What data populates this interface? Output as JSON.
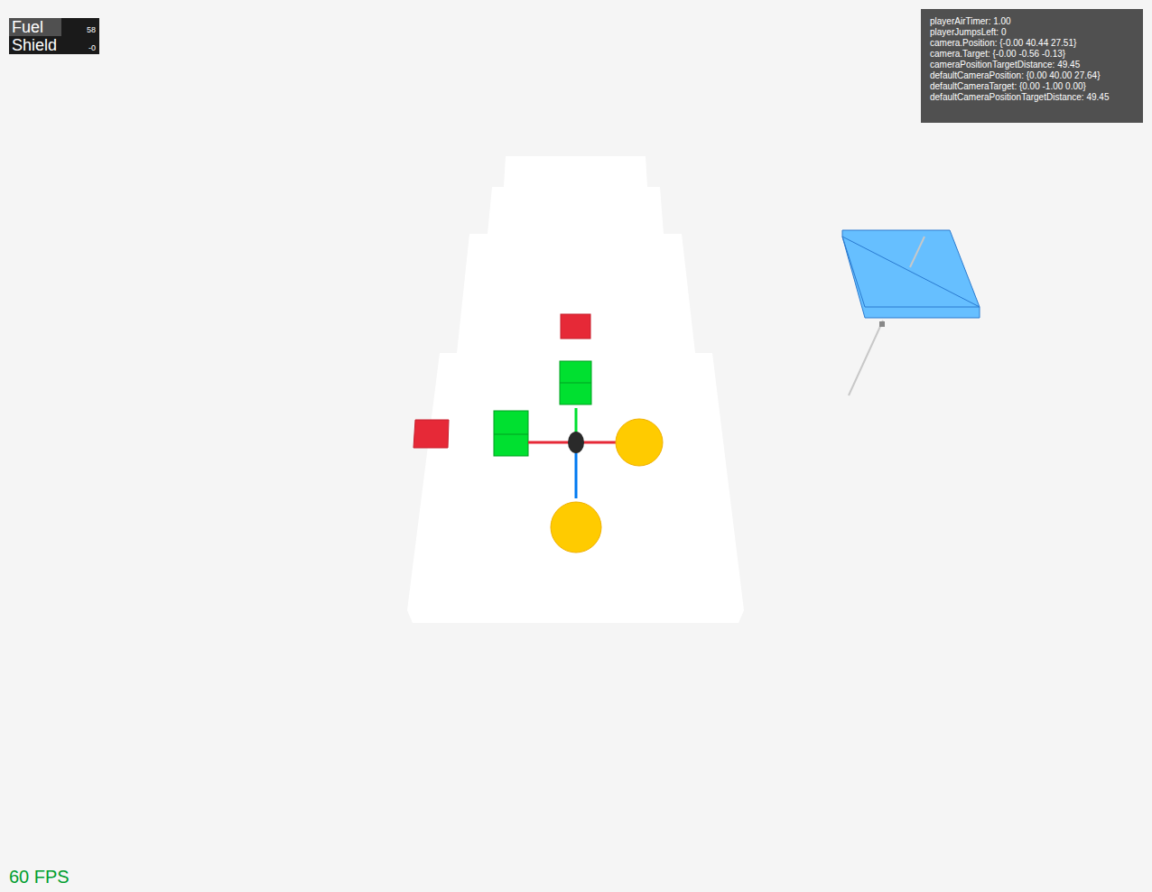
{
  "hud": {
    "bars": [
      {
        "label": "Fuel",
        "value": "58",
        "level": 0.58
      },
      {
        "label": "Shield",
        "value": "-0",
        "level": 0
      }
    ]
  },
  "debug": {
    "lines": [
      "playerAirTimer: 1.00",
      "playerJumpsLeft: 0",
      "camera.Position: {-0.00 40.44 27.51}",
      "camera.Target: {-0.00 -0.56 -0.13}",
      "cameraPositionTargetDistance: 49.45",
      "defaultCameraPosition: {0.00 40.00 27.64}",
      "defaultCameraTarget: {0.00 -1.00 0.00}",
      "defaultCameraPositionTargetDistance: 49.45"
    ]
  },
  "fps": "60 FPS"
}
